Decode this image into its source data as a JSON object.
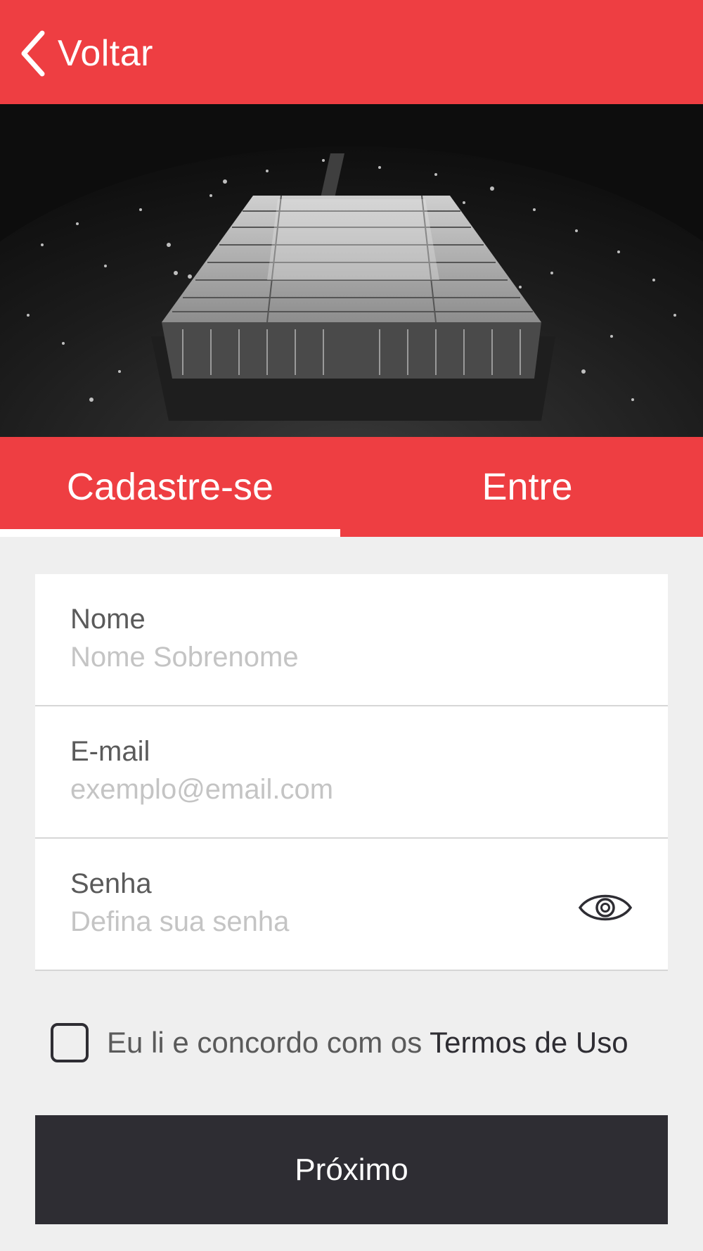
{
  "header": {
    "back_label": "Voltar"
  },
  "tabs": [
    {
      "label": "Cadastre-se",
      "active": true
    },
    {
      "label": "Entre",
      "active": false
    }
  ],
  "form": {
    "name": {
      "label": "Nome",
      "placeholder": "Nome Sobrenome",
      "value": ""
    },
    "email": {
      "label": "E-mail",
      "placeholder": "exemplo@email.com",
      "value": ""
    },
    "password": {
      "label": "Senha",
      "placeholder": "Defina sua senha",
      "value": "",
      "toggle_icon": "eye-icon"
    }
  },
  "terms": {
    "checked": false,
    "text": "Eu li e concordo com os ",
    "link": "Termos de Uso"
  },
  "next_button": "Próximo",
  "colors": {
    "brand_red": "#ee3e42",
    "dark": "#2e2d33",
    "background": "#efefef"
  }
}
